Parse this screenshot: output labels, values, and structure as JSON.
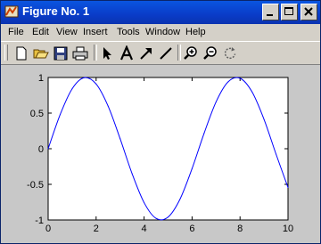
{
  "window": {
    "title": "Figure No. 1",
    "title_icon": "matlab-figure-icon",
    "controls": [
      "minimize-icon",
      "maximize-icon",
      "close-icon"
    ]
  },
  "menu": {
    "items": [
      {
        "label": "File"
      },
      {
        "label": "Edit"
      },
      {
        "label": "View"
      },
      {
        "label": "Insert"
      },
      {
        "label": "Tools"
      },
      {
        "label": "Window"
      },
      {
        "label": "Help"
      }
    ]
  },
  "toolbar": {
    "icons": [
      "new-figure-icon",
      "open-file-icon",
      "save-icon",
      "print-icon",
      "select-arrow-icon",
      "insert-text-icon",
      "insert-arrow-icon",
      "insert-line-icon",
      "zoom-in-icon",
      "zoom-out-icon",
      "rotate-icon"
    ]
  },
  "colors": {
    "titlebar": "#0a3cc8",
    "line": "#0000ff",
    "axes_bg": "#ffffff",
    "figure_bg": "#c8c8c8"
  },
  "chart_data": {
    "type": "line",
    "function": "sin(x)",
    "x": [
      0,
      0.5,
      1,
      1.5,
      2,
      2.5,
      3,
      3.5,
      4,
      4.5,
      5,
      5.5,
      6,
      6.5,
      7,
      7.5,
      8,
      8.5,
      9,
      9.5,
      10
    ],
    "y": [
      0,
      0.479,
      0.841,
      0.997,
      0.909,
      0.598,
      0.141,
      -0.351,
      -0.757,
      -0.978,
      -0.959,
      -0.706,
      -0.279,
      0.215,
      0.657,
      0.938,
      0.989,
      0.798,
      0.412,
      -0.075,
      -0.544
    ],
    "xlim": [
      0,
      10
    ],
    "ylim": [
      -1,
      1
    ],
    "xticks": [
      0,
      2,
      4,
      6,
      8,
      10
    ],
    "xtick_labels": [
      "0",
      "2",
      "4",
      "6",
      "8",
      "10"
    ],
    "yticks": [
      1,
      0.5,
      0,
      -0.5,
      -1
    ],
    "ytick_labels": [
      "1",
      "0.5",
      "0",
      "-0.5",
      "-1"
    ],
    "grid": false,
    "line_color": "#0000ff"
  }
}
